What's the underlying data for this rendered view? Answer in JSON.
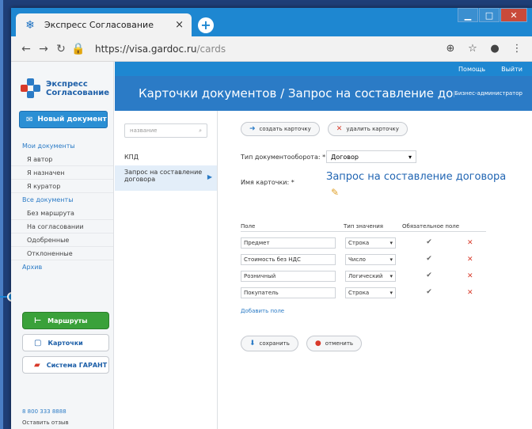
{
  "browser": {
    "tab_title": "Экспресс Согласование",
    "tab_close": "×",
    "new_tab": "+",
    "url_domain": "https://visa.gardoc.ru",
    "url_path": "/cards"
  },
  "app": {
    "logo_line1": "Экспресс",
    "logo_line2": "Согласование",
    "new_document": "Новый документ",
    "menu": {
      "my_docs": "Мои документы",
      "author": "Я автор",
      "assigned": "Я назначен",
      "curator": "Я куратор",
      "all_docs": "Все документы",
      "no_route": "Без маршрута",
      "on_approval": "На согласовании",
      "approved": "Одобренные",
      "rejected": "Отклоненные",
      "archive": "Архив"
    },
    "routes_button": "Маршруты",
    "cards_button": "Карточки",
    "garant_button": "Система ГАРАНТ",
    "phone": "8 800 333 8888",
    "feedback": "Оставить отзыв"
  },
  "topnav": {
    "help": "Помощь",
    "logout": "Выйти"
  },
  "header": {
    "title": "Карточки документов / Запрос на составление договора",
    "role": "Бизнес-администратор"
  },
  "card_list": {
    "search_placeholder": "название",
    "items": [
      "КПД",
      "Запрос на составление договора"
    ]
  },
  "editor": {
    "create_card": "создать карточку",
    "delete_card": "удалить карточку",
    "workflow_type_label": "Тип документооборота:",
    "workflow_type_value": "Договор",
    "card_name_label": "Имя карточки:",
    "required_mark": "*",
    "card_name_value": "Запрос на составление договора",
    "col_field": "Поле",
    "col_value_type": "Тип значения",
    "col_required": "Обязательное поле",
    "fields": [
      {
        "name": "Предмет",
        "type": "Строка"
      },
      {
        "name": "Стоимость без НДС",
        "type": "Число"
      },
      {
        "name": "Розничный",
        "type": "Логический"
      },
      {
        "name": "Покупатель",
        "type": "Строка"
      }
    ],
    "add_field": "Добавить поле",
    "save": "сохранить",
    "cancel": "отменить"
  }
}
